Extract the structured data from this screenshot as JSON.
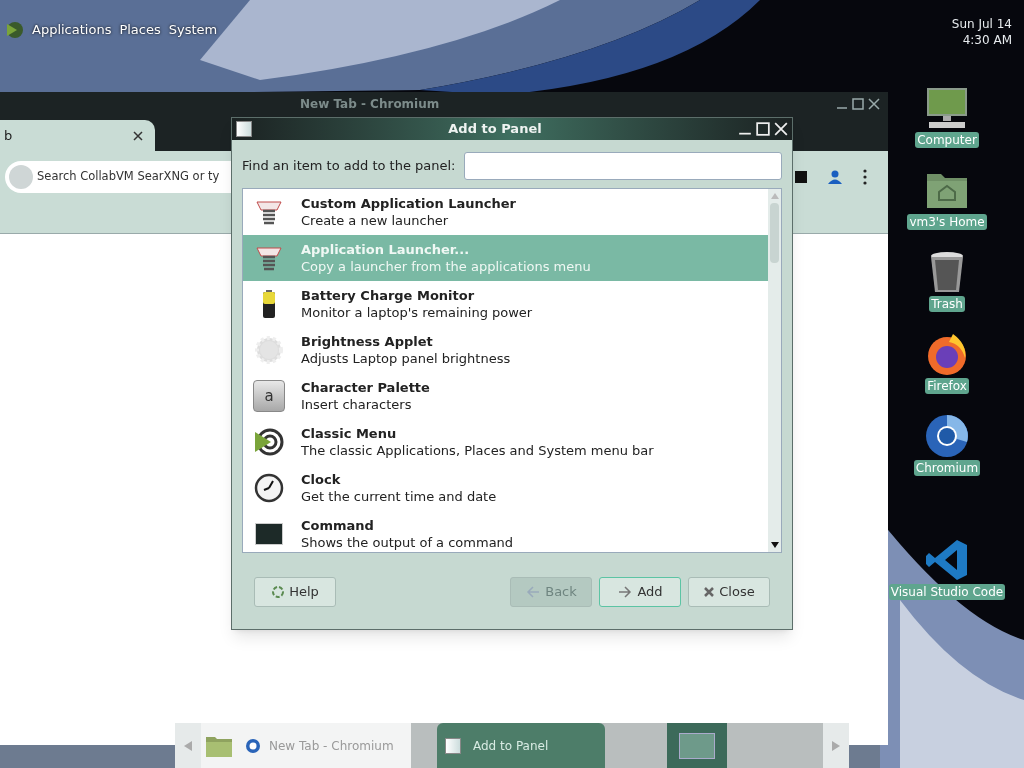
{
  "top_panel": {
    "menus": [
      "Applications",
      "Places",
      "System"
    ],
    "clock": [
      "Sun Jul 14",
      "4:30 AM"
    ]
  },
  "browser": {
    "title": "New Tab - Chromium",
    "tab_label": "b",
    "address_placeholder": "Search CollabVM SearXNG or ty"
  },
  "dialog": {
    "title": "Add to Panel",
    "find_label": "Find an item to add to the panel:",
    "items": [
      {
        "kind": "launcher",
        "name": "Custom Application Launcher",
        "description": "Create a new launcher",
        "selected": false
      },
      {
        "kind": "launcher",
        "name": "Application Launcher...",
        "description": "Copy a launcher from the applications menu",
        "selected": true
      },
      {
        "kind": "battery",
        "name": "Battery Charge Monitor",
        "description": "Monitor a laptop's remaining power",
        "selected": false
      },
      {
        "kind": "brightness",
        "name": "Brightness Applet",
        "description": "Adjusts Laptop panel brightness",
        "selected": false
      },
      {
        "kind": "palette",
        "name": "Character Palette",
        "description": "Insert characters",
        "selected": false,
        "glyph": "a"
      },
      {
        "kind": "menu",
        "name": "Classic Menu",
        "description": "The classic Applications, Places and System menu bar",
        "selected": false
      },
      {
        "kind": "clock",
        "name": "Clock",
        "description": "Get the current time and date",
        "selected": false
      },
      {
        "kind": "terminal",
        "name": "Command",
        "description": "Shows the output of a command",
        "selected": false
      }
    ],
    "buttons": [
      {
        "kind": "help",
        "label": "Help",
        "disabled": false,
        "focused": false
      },
      {
        "kind": "back",
        "label": "Back",
        "disabled": true,
        "focused": false
      },
      {
        "kind": "add",
        "label": "Add",
        "disabled": false,
        "focused": true
      },
      {
        "kind": "close",
        "label": "Close",
        "disabled": false,
        "focused": false
      }
    ]
  },
  "desktop_icons": [
    {
      "kind": "computer",
      "label": "Computer"
    },
    {
      "kind": "home",
      "label": "vm3's Home"
    },
    {
      "kind": "trash",
      "label": "Trash"
    },
    {
      "kind": "firefox",
      "label": "Firefox"
    },
    {
      "kind": "chromium",
      "label": "Chromium"
    },
    {
      "kind": "vscode",
      "label": "Visual Studio Code"
    }
  ],
  "taskbar": {
    "items": [
      {
        "kind": "chromium",
        "label": "New Tab - Chromium",
        "selected": false
      },
      {
        "kind": "dialog",
        "label": "Add to Panel",
        "selected": true
      }
    ]
  }
}
